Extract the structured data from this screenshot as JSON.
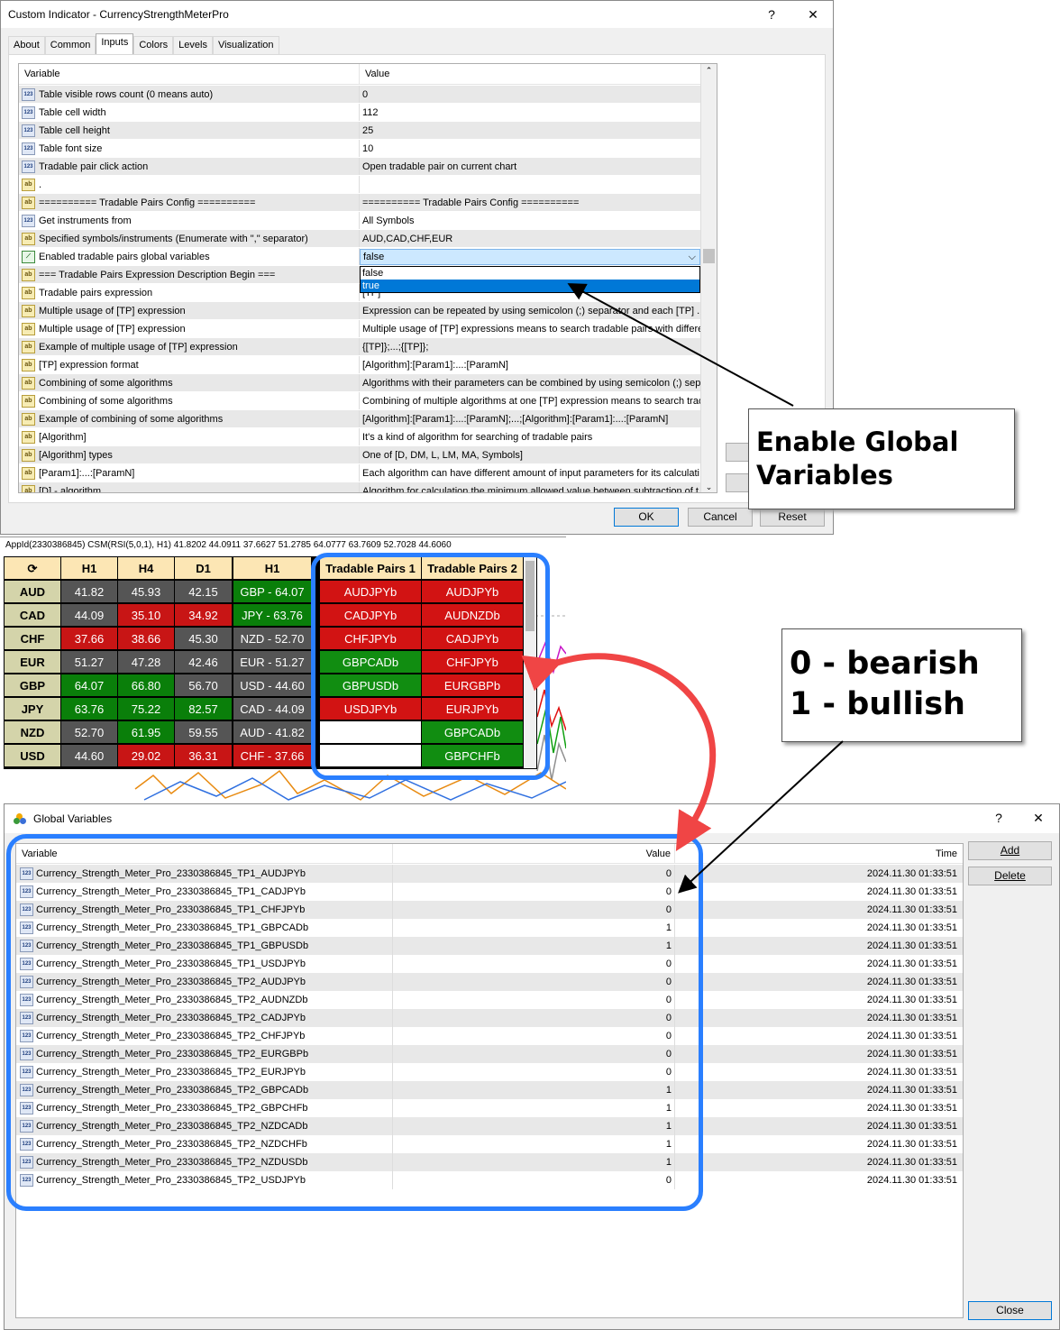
{
  "dialog": {
    "title": "Custom Indicator - CurrencyStrengthMeterPro",
    "help": "?",
    "close": "✕",
    "tabs": [
      "About",
      "Common",
      "Inputs",
      "Colors",
      "Levels",
      "Visualization"
    ],
    "active_tab": "Inputs",
    "col_variable": "Variable",
    "col_value": "Value",
    "params": [
      {
        "icon": "123",
        "name": "Table visible rows count (0 means auto)",
        "value": "0"
      },
      {
        "icon": "123",
        "name": "Table cell width",
        "value": "112"
      },
      {
        "icon": "123",
        "name": "Table cell height",
        "value": "25"
      },
      {
        "icon": "123",
        "name": "Table font size",
        "value": "10"
      },
      {
        "icon": "123",
        "name": "Tradable pair click action",
        "value": "Open tradable pair on current chart"
      },
      {
        "icon": "ab",
        "name": ".",
        "value": ""
      },
      {
        "icon": "ab",
        "name": "========== Tradable Pairs Config ==========",
        "value": "========== Tradable Pairs Config =========="
      },
      {
        "icon": "123",
        "name": "Get instruments from",
        "value": "All Symbols"
      },
      {
        "icon": "ab",
        "name": "Specified symbols/instruments (Enumerate with \",\" separator)",
        "value": "AUD,CAD,CHF,EUR"
      },
      {
        "icon": "bool",
        "name": "Enabled tradable pairs global variables",
        "value": "false"
      },
      {
        "icon": "ab",
        "name": "=== Tradable Pairs Expression Description Begin ===",
        "value": ""
      },
      {
        "icon": "ab",
        "name": "Tradable pairs expression",
        "value": "[TP]"
      },
      {
        "icon": "ab",
        "name": "Multiple usage of [TP] expression",
        "value": "Expression can be repeated by using semicolon (;) separator and each [TP] ..."
      },
      {
        "icon": "ab",
        "name": "Multiple usage of [TP] expression",
        "value": "Multiple usage of [TP] expressions means to search tradable pairs with differe..."
      },
      {
        "icon": "ab",
        "name": "Example of multiple usage of [TP] expression",
        "value": "{[TP]};...;{[TP]};"
      },
      {
        "icon": "ab",
        "name": "[TP] expression format",
        "value": "[Algorithm]:[Param1]:...:[ParamN]"
      },
      {
        "icon": "ab",
        "name": "Combining of some algorithms",
        "value": "Algorithms with their parameters can be combined by using semicolon (;) sep..."
      },
      {
        "icon": "ab",
        "name": "Combining of some algorithms",
        "value": "Combining of multiple algorithms at one [TP] expression means to search trad..."
      },
      {
        "icon": "ab",
        "name": "Example of combining of some algorithms",
        "value": "[Algorithm]:[Param1]:...:[ParamN];...;[Algorithm]:[Param1]:...:[ParamN]"
      },
      {
        "icon": "ab",
        "name": "[Algorithm]",
        "value": "It's a kind of algorithm for searching of tradable pairs"
      },
      {
        "icon": "ab",
        "name": "[Algorithm] types",
        "value": "One of [D, DM, L, LM, MA, Symbols]"
      },
      {
        "icon": "ab",
        "name": "[Param1]:...:[ParamN]",
        "value": "Each algorithm can have different amount of input parameters for its calculati..."
      },
      {
        "icon": "ab",
        "name": "[D] - algorithm",
        "value": "Algorithm for calculation the minimum allowed value between subtraction of t..."
      }
    ],
    "dropdown_value": "false",
    "dropdown_arrow": "⌵",
    "dropdown_options": [
      "false",
      "true"
    ],
    "ok": "OK",
    "cancel": "Cancel",
    "reset": "Reset"
  },
  "callout_global": {
    "line1": "Enable Global",
    "line2": "Variables"
  },
  "callout_bear": {
    "line1": "0 - bearish",
    "line2": "1 - bullish"
  },
  "chart": {
    "info": "AppId(2330386845) CSM(RSI(5,0,1), H1) 41.8202 44.0911 37.6627 51.2785 64.0777 63.7609 52.7028 44.6060",
    "refresh_icon": "⟳",
    "tf_headers": [
      "H1",
      "H4",
      "D1"
    ],
    "sorted_header": "H1",
    "tp1_header": "Tradable Pairs 1",
    "tp2_header": "Tradable Pairs 2",
    "rows": [
      {
        "cur": "AUD",
        "h1": "41.82",
        "h4": "45.93",
        "d1": "42.15",
        "sorted": "GBP - 64.07",
        "tp1": "AUDJPYb",
        "tp2": "AUDJPYb"
      },
      {
        "cur": "CAD",
        "h1": "44.09",
        "h4": "35.10",
        "d1": "34.92",
        "sorted": "JPY - 63.76",
        "tp1": "CADJPYb",
        "tp2": "AUDNZDb"
      },
      {
        "cur": "CHF",
        "h1": "37.66",
        "h4": "38.66",
        "d1": "45.30",
        "sorted": "NZD - 52.70",
        "tp1": "CHFJPYb",
        "tp2": "CADJPYb"
      },
      {
        "cur": "EUR",
        "h1": "51.27",
        "h4": "47.28",
        "d1": "42.46",
        "sorted": "EUR - 51.27",
        "tp1": "GBPCADb",
        "tp2": "CHFJPYb"
      },
      {
        "cur": "GBP",
        "h1": "64.07",
        "h4": "66.80",
        "d1": "56.70",
        "sorted": "USD - 44.60",
        "tp1": "GBPUSDb",
        "tp2": "EURGBPb"
      },
      {
        "cur": "JPY",
        "h1": "63.76",
        "h4": "75.22",
        "d1": "82.57",
        "sorted": "CAD - 44.09",
        "tp1": "USDJPYb",
        "tp2": "EURJPYb"
      },
      {
        "cur": "NZD",
        "h1": "52.70",
        "h4": "61.95",
        "d1": "59.55",
        "sorted": "AUD - 41.82",
        "tp1": "",
        "tp2": "GBPCADb"
      },
      {
        "cur": "USD",
        "h1": "44.60",
        "h4": "29.02",
        "d1": "36.31",
        "sorted": "CHF - 37.66",
        "tp1": "",
        "tp2": "GBPCHFb"
      }
    ]
  },
  "gv": {
    "title": "Global Variables",
    "help": "?",
    "close": "✕",
    "col_variable": "Variable",
    "col_value": "Value",
    "col_time": "Time",
    "add": "Add",
    "delete": "Delete",
    "close_btn": "Close",
    "rows": [
      {
        "name": "Currency_Strength_Meter_Pro_2330386845_TP1_AUDJPYb",
        "value": "0",
        "time": "2024.11.30 01:33:51"
      },
      {
        "name": "Currency_Strength_Meter_Pro_2330386845_TP1_CADJPYb",
        "value": "0",
        "time": "2024.11.30 01:33:51"
      },
      {
        "name": "Currency_Strength_Meter_Pro_2330386845_TP1_CHFJPYb",
        "value": "0",
        "time": "2024.11.30 01:33:51"
      },
      {
        "name": "Currency_Strength_Meter_Pro_2330386845_TP1_GBPCADb",
        "value": "1",
        "time": "2024.11.30 01:33:51"
      },
      {
        "name": "Currency_Strength_Meter_Pro_2330386845_TP1_GBPUSDb",
        "value": "1",
        "time": "2024.11.30 01:33:51"
      },
      {
        "name": "Currency_Strength_Meter_Pro_2330386845_TP1_USDJPYb",
        "value": "0",
        "time": "2024.11.30 01:33:51"
      },
      {
        "name": "Currency_Strength_Meter_Pro_2330386845_TP2_AUDJPYb",
        "value": "0",
        "time": "2024.11.30 01:33:51"
      },
      {
        "name": "Currency_Strength_Meter_Pro_2330386845_TP2_AUDNZDb",
        "value": "0",
        "time": "2024.11.30 01:33:51"
      },
      {
        "name": "Currency_Strength_Meter_Pro_2330386845_TP2_CADJPYb",
        "value": "0",
        "time": "2024.11.30 01:33:51"
      },
      {
        "name": "Currency_Strength_Meter_Pro_2330386845_TP2_CHFJPYb",
        "value": "0",
        "time": "2024.11.30 01:33:51"
      },
      {
        "name": "Currency_Strength_Meter_Pro_2330386845_TP2_EURGBPb",
        "value": "0",
        "time": "2024.11.30 01:33:51"
      },
      {
        "name": "Currency_Strength_Meter_Pro_2330386845_TP2_EURJPYb",
        "value": "0",
        "time": "2024.11.30 01:33:51"
      },
      {
        "name": "Currency_Strength_Meter_Pro_2330386845_TP2_GBPCADb",
        "value": "1",
        "time": "2024.11.30 01:33:51"
      },
      {
        "name": "Currency_Strength_Meter_Pro_2330386845_TP2_GBPCHFb",
        "value": "1",
        "time": "2024.11.30 01:33:51"
      },
      {
        "name": "Currency_Strength_Meter_Pro_2330386845_TP2_NZDCADb",
        "value": "1",
        "time": "2024.11.30 01:33:51"
      },
      {
        "name": "Currency_Strength_Meter_Pro_2330386845_TP2_NZDCHFb",
        "value": "1",
        "time": "2024.11.30 01:33:51"
      },
      {
        "name": "Currency_Strength_Meter_Pro_2330386845_TP2_NZDUSDb",
        "value": "1",
        "time": "2024.11.30 01:33:51"
      },
      {
        "name": "Currency_Strength_Meter_Pro_2330386845_TP2_USDJPYb",
        "value": "0",
        "time": "2024.11.30 01:33:51"
      }
    ]
  },
  "colors": {
    "annotation_blue": "#2a7fff",
    "arrow_red": "#f04545",
    "bull_green": "#0a7f0a",
    "bear_red": "#c81515"
  }
}
